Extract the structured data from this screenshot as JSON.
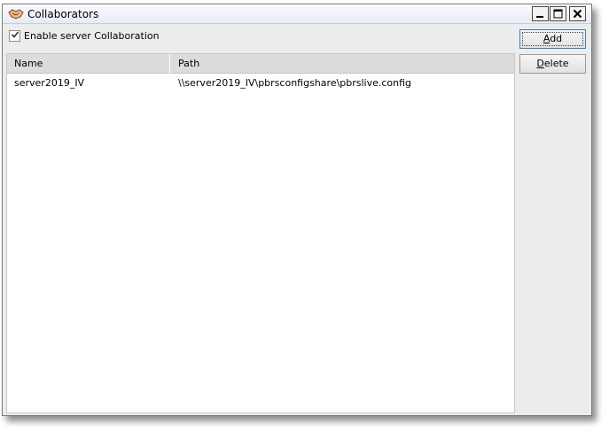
{
  "window": {
    "title": "Collaborators",
    "icon": "handshake-icon",
    "controls": [
      "minimize-icon",
      "maximize-icon",
      "close-icon"
    ]
  },
  "options": {
    "enable_collab_label": "Enable server Collaboration",
    "enable_collab_checked": true
  },
  "table": {
    "columns": [
      "Name",
      "Path"
    ],
    "rows": [
      {
        "name": "server2019_IV",
        "path": "\\\\server2019_IV\\pbrsconfigshare\\pbrslive.config"
      }
    ]
  },
  "buttons": {
    "add_label": "Add",
    "delete_label": "Delete"
  },
  "colors": {
    "title_bar": "#e7ecf4",
    "client_bg": "#ececec",
    "header_bg": "#dcdcdc",
    "list_bg": "#ffffff"
  }
}
